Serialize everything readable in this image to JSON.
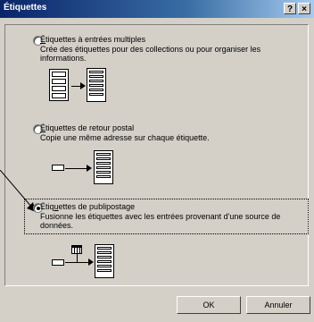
{
  "window": {
    "title": "Étiquettes",
    "help_button": "?",
    "close_button": "×"
  },
  "options": [
    {
      "title_mnemonic": "É",
      "title_rest": "tiquettes à entrées multiples",
      "description": "Crée des étiquettes pour des collections ou pour organiser les informations.",
      "selected": false
    },
    {
      "title_mnemonic": "É",
      "title_rest": "tiquettes de retour postal",
      "description": "Copie une même adresse sur chaque étiquette.",
      "selected": false
    },
    {
      "title_pre": "Étiq",
      "title_mnemonic": "u",
      "title_rest": "ettes de publipostage",
      "description": "Fusionne les étiquettes avec les entrées provenant d'une source de données.",
      "selected": true
    }
  ],
  "buttons": {
    "ok": "OK",
    "cancel": "Annuler"
  }
}
